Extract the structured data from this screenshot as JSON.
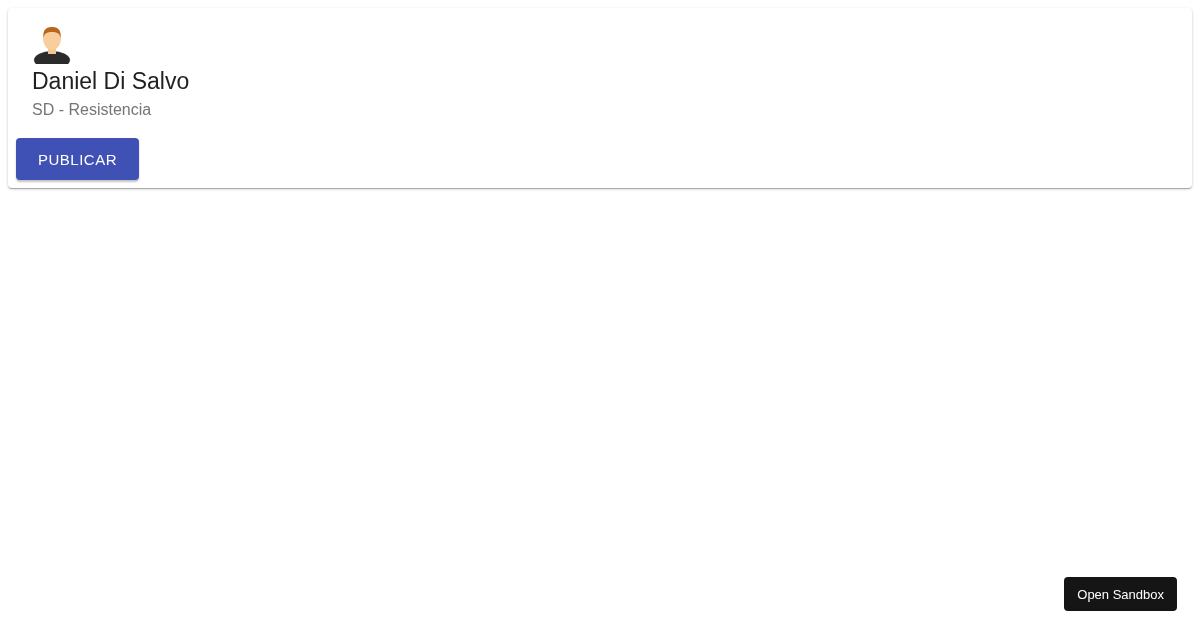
{
  "card": {
    "name": "Daniel Di Salvo",
    "subtitle": "SD - Resistencia",
    "action": "PUBLICAR"
  },
  "sandbox_button": "Open Sandbox"
}
